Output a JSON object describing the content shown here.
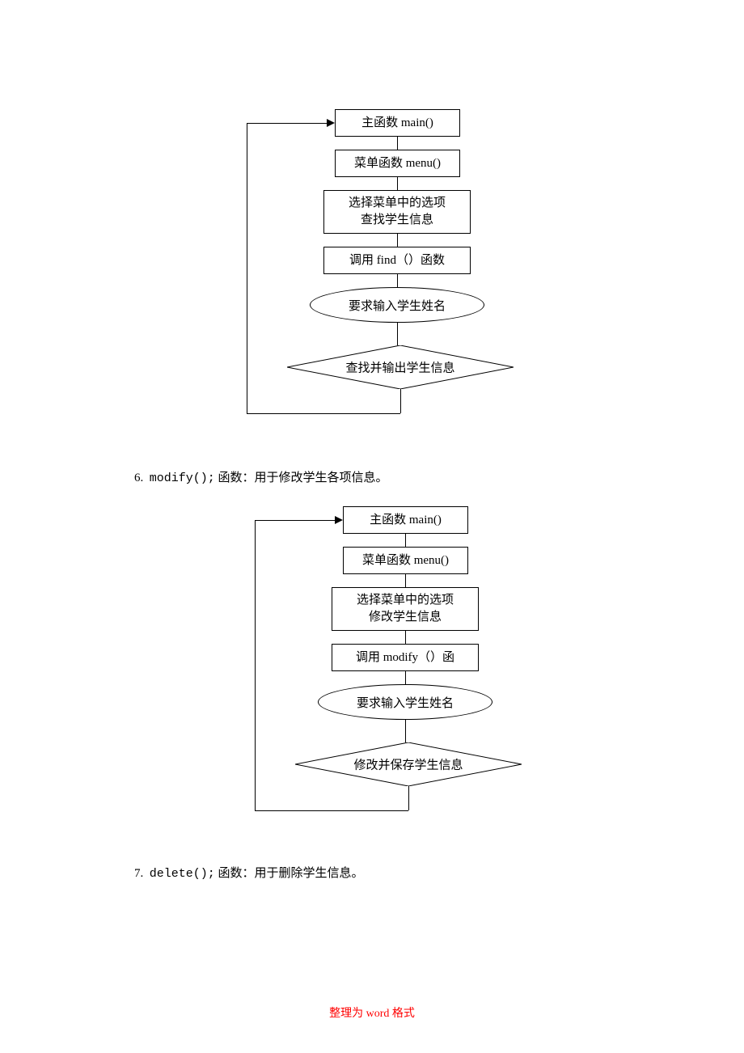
{
  "flow1": {
    "box1": "主函数 main()",
    "box2": "菜单函数 menu()",
    "box3_line1": "选择菜单中的选项",
    "box3_line2": "查找学生信息",
    "box4": "调用 find（）函数",
    "ellipse": "要求输入学生姓名",
    "diamond": "查找并输出学生信息"
  },
  "flow2": {
    "box1": "主函数 main()",
    "box2": "菜单函数 menu()",
    "box3_line1": "选择菜单中的选项",
    "box3_line2": "修改学生信息",
    "box4": "调用 modify（）函",
    "ellipse": "要求输入学生姓名",
    "diamond": "修改并保存学生信息"
  },
  "item6": {
    "num": "6.",
    "func": "modify();",
    "desc": "函数：用于修改学生各项信息。"
  },
  "item7": {
    "num": "7.",
    "func": "delete();",
    "desc": "函数：用于删除学生信息。"
  },
  "footer": "整理为 word 格式"
}
